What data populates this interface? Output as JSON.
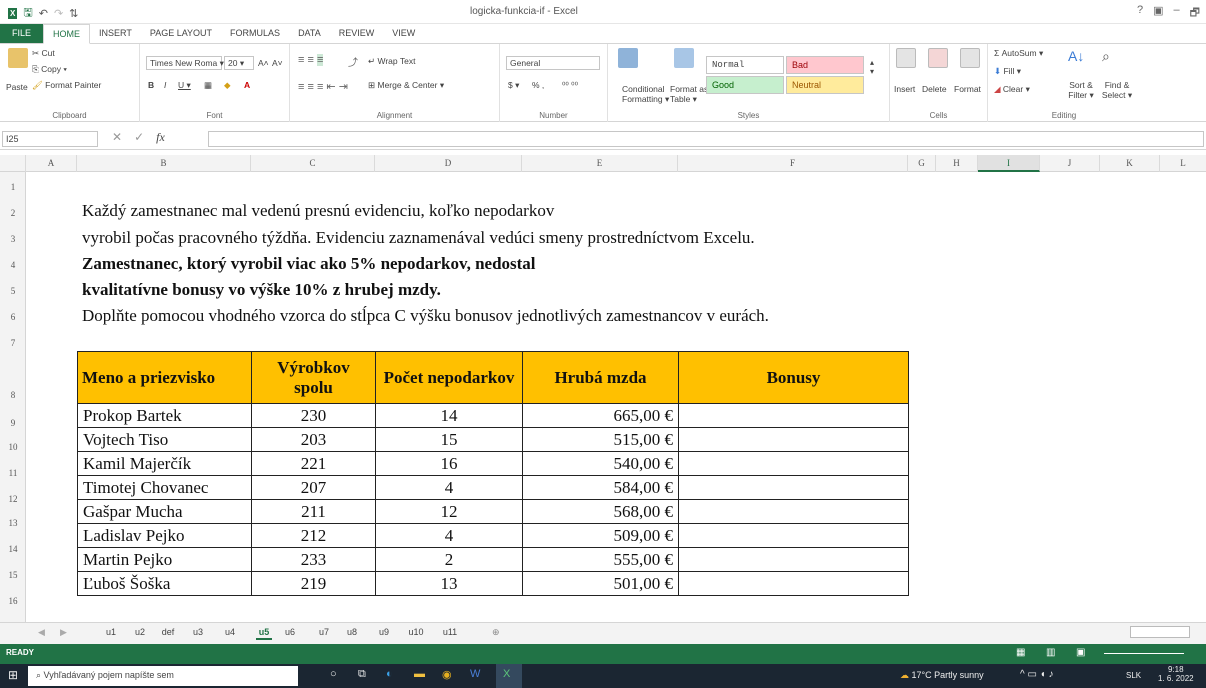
{
  "title_bar": {
    "window_title": "logicka-funkcia-if - Excel",
    "controls": [
      "?",
      "▣",
      "–",
      "🗗"
    ]
  },
  "ribbon_tabs": [
    "FILE",
    "HOME",
    "INSERT",
    "PAGE LAYOUT",
    "FORMULAS",
    "DATA",
    "REVIEW",
    "VIEW"
  ],
  "ribbon": {
    "clipboard": {
      "paste": "Paste",
      "cut": "Cut",
      "copy": "Copy ▾",
      "format_painter": "Format Painter",
      "label": "Clipboard"
    },
    "font": {
      "name": "Times New Roma ▾",
      "size": "20 ▾",
      "grow": "A˄",
      "shrink": "A˅",
      "bold": "B",
      "italic": "I",
      "underline": "U ▾",
      "label": "Font"
    },
    "alignment": {
      "wrap": "Wrap Text",
      "merge": "Merge & Center ▾",
      "label": "Alignment"
    },
    "number": {
      "format": "General",
      "percent": "% ,",
      "label": "Number"
    },
    "styles": {
      "conditional": "Conditional Formatting ▾",
      "format_table": "Format as Table ▾",
      "normal": "Normal",
      "bad": "Bad",
      "good": "Good",
      "neutral": "Neutral",
      "label": "Styles"
    },
    "cells": {
      "insert": "Insert",
      "delete": "Delete",
      "format": "Format",
      "label": "Cells"
    },
    "editing": {
      "autosum": "AutoSum ▾",
      "fill": "Fill ▾",
      "clear": "Clear ▾",
      "sort": "Sort & Filter ▾",
      "find": "Find & Select ▾",
      "label": "Editing"
    }
  },
  "formula_bar": {
    "name_box": "I25",
    "fx": "fx",
    "content": ""
  },
  "columns": [
    "A",
    "B",
    "C",
    "D",
    "E",
    "F",
    "G",
    "H",
    "I",
    "J",
    "K",
    "L"
  ],
  "rows": [
    "1",
    "2",
    "3",
    "4",
    "5",
    "6",
    "7",
    "8",
    "9",
    "10",
    "11",
    "12",
    "13",
    "14",
    "15",
    "16"
  ],
  "paragraphs": [
    "Každý zamestnanec mal vedenú presnú evidenciu, koľko nepodarkov",
    "vyrobil počas pracovného týždňa. Evidenciu zaznamenával vedúci smeny prostredníctvom Excelu.",
    "Zamestnanec, ktorý vyrobil viac ako 5% nepodarkov, nedostal",
    "kvalitatívne bonusy vo výške 10% z hrubej mzdy.",
    "Doplňte pomocou vhodného vzorca do stĺpca C výšku bonusov jednotlivých zamestnancov v eurách."
  ],
  "table": {
    "headers": [
      "Meno a priezvisko",
      "Výrobkov spolu",
      "Počet nepodarkov",
      "Hrubá mzda",
      "Bonusy"
    ],
    "rows": [
      [
        "Prokop Bartek",
        "230",
        "14",
        "665,00 €",
        ""
      ],
      [
        "Vojtech Tiso",
        "203",
        "15",
        "515,00 €",
        ""
      ],
      [
        "Kamil Majerčík",
        "221",
        "16",
        "540,00 €",
        ""
      ],
      [
        "Timotej Chovanec",
        "207",
        "4",
        "584,00 €",
        ""
      ],
      [
        "Gašpar Mucha",
        "211",
        "12",
        "568,00 €",
        ""
      ],
      [
        "Ladislav Pejko",
        "212",
        "4",
        "509,00 €",
        ""
      ],
      [
        "Martin Pejko",
        "233",
        "2",
        "555,00 €",
        ""
      ],
      [
        "Ľuboš Šoška",
        "219",
        "13",
        "501,00 €",
        ""
      ]
    ]
  },
  "sheet_tabs": [
    "u1",
    "u2",
    "def",
    "u3",
    "u4",
    "u5",
    "u6",
    "u7",
    "u8",
    "u9",
    "u10",
    "u11"
  ],
  "active_sheet": "u5",
  "status_bar": {
    "state": "READY"
  },
  "taskbar": {
    "search_placeholder": "Vyhľadávaný pojem napíšte sem",
    "weather": "17°C Partly sunny",
    "lang": "SLK",
    "time": "9:18",
    "date": "1. 6. 2022"
  },
  "colors": {
    "excel_green": "#217346",
    "header_fill": "#ffc000",
    "bad": "#ffc7ce",
    "good": "#c6efce",
    "neutral": "#ffeb9c"
  }
}
